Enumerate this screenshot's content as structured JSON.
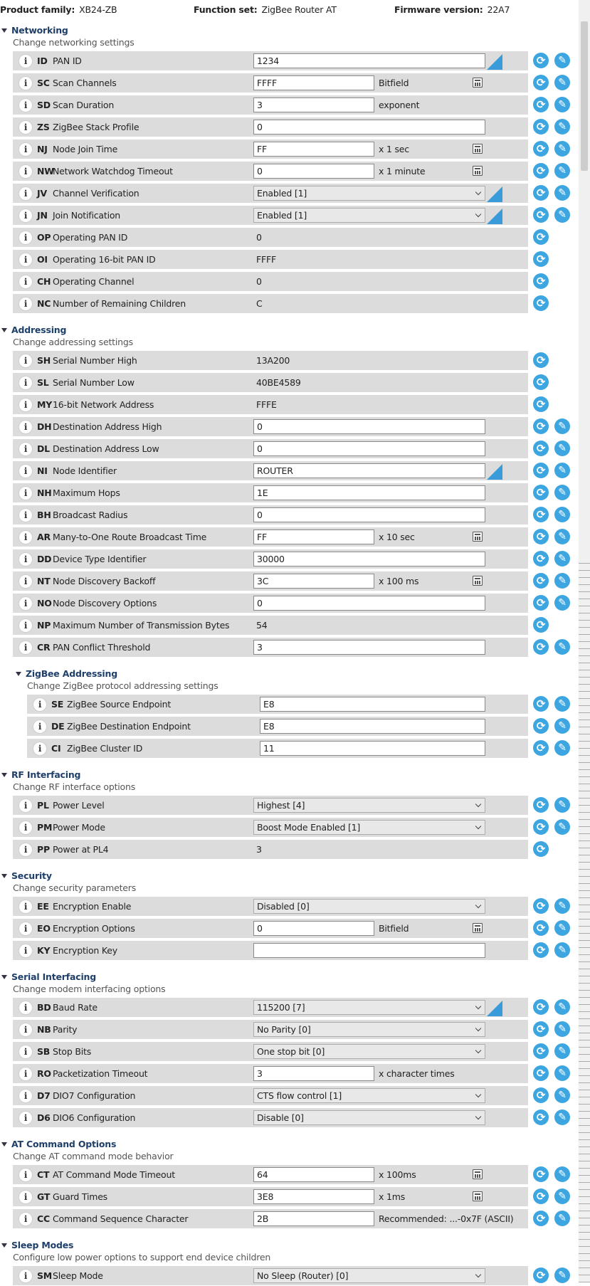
{
  "header": {
    "product_family_label": "Product family:",
    "product_family_value": "XB24-ZB",
    "function_set_label": "Function set:",
    "function_set_value": "ZigBee Router AT",
    "firmware_label": "Firmware version:",
    "firmware_value": "22A7"
  },
  "icons": {
    "info": "i",
    "read": "⟳",
    "write": "✎"
  },
  "colors": {
    "accent": "#3da6e0",
    "section_title": "#1f3f6b",
    "row_bg": "#dcdcdc"
  },
  "sections": [
    {
      "title": "Networking",
      "description": "Change networking settings",
      "rows": [
        {
          "code": "ID",
          "name": "PAN ID",
          "kind": "input",
          "value": "1234",
          "changed": true
        },
        {
          "code": "SC",
          "name": "Scan Channels",
          "kind": "input_short",
          "value": "FFFF",
          "unit": "Bitfield",
          "calc": true
        },
        {
          "code": "SD",
          "name": "Scan Duration",
          "kind": "input_short",
          "value": "3",
          "unit": "exponent"
        },
        {
          "code": "ZS",
          "name": "ZigBee Stack Profile",
          "kind": "input",
          "value": "0"
        },
        {
          "code": "NJ",
          "name": "Node Join Time",
          "kind": "input_short",
          "value": "FF",
          "unit": "x 1 sec",
          "calc": true
        },
        {
          "code": "NW",
          "name": "Network Watchdog Timeout",
          "kind": "input_short",
          "value": "0",
          "unit": "x 1 minute",
          "calc": true
        },
        {
          "code": "JV",
          "name": "Channel Verification",
          "kind": "select",
          "value": "Enabled [1]",
          "changed": true
        },
        {
          "code": "JN",
          "name": "Join Notification",
          "kind": "select",
          "value": "Enabled [1]",
          "changed": true
        },
        {
          "code": "OP",
          "name": "Operating PAN ID",
          "kind": "readonly",
          "value": "0"
        },
        {
          "code": "OI",
          "name": "Operating 16-bit PAN ID",
          "kind": "readonly",
          "value": "FFFF"
        },
        {
          "code": "CH",
          "name": "Operating Channel",
          "kind": "readonly",
          "value": "0"
        },
        {
          "code": "NC",
          "name": "Number of Remaining Children",
          "kind": "readonly",
          "value": "C"
        }
      ]
    },
    {
      "title": "Addressing",
      "description": "Change addressing settings",
      "rows": [
        {
          "code": "SH",
          "name": "Serial Number High",
          "kind": "readonly",
          "value": "13A200"
        },
        {
          "code": "SL",
          "name": "Serial Number Low",
          "kind": "readonly",
          "value": "40BE4589"
        },
        {
          "code": "MY",
          "name": "16-bit Network Address",
          "kind": "readonly",
          "value": "FFFE"
        },
        {
          "code": "DH",
          "name": "Destination Address High",
          "kind": "input",
          "value": "0"
        },
        {
          "code": "DL",
          "name": "Destination Address Low",
          "kind": "input",
          "value": "0"
        },
        {
          "code": "NI",
          "name": "Node Identifier",
          "kind": "input",
          "value": "ROUTER",
          "changed": true
        },
        {
          "code": "NH",
          "name": "Maximum Hops",
          "kind": "input",
          "value": "1E"
        },
        {
          "code": "BH",
          "name": "Broadcast Radius",
          "kind": "input",
          "value": "0"
        },
        {
          "code": "AR",
          "name": "Many-to-One Route Broadcast Time",
          "kind": "input_short",
          "value": "FF",
          "unit": "x 10 sec",
          "calc": true
        },
        {
          "code": "DD",
          "name": "Device Type Identifier",
          "kind": "input",
          "value": "30000"
        },
        {
          "code": "NT",
          "name": "Node Discovery Backoff",
          "kind": "input_short",
          "value": "3C",
          "unit": "x 100 ms",
          "calc": true
        },
        {
          "code": "NO",
          "name": "Node Discovery Options",
          "kind": "input",
          "value": "0"
        },
        {
          "code": "NP",
          "name": "Maximum Number of Transmission Bytes",
          "kind": "readonly",
          "value": "54"
        },
        {
          "code": "CR",
          "name": "PAN Conflict Threshold",
          "kind": "input",
          "value": "3"
        }
      ]
    },
    {
      "title": "ZigBee Addressing",
      "description": "Change ZigBee protocol addressing settings",
      "sub": true,
      "rows": [
        {
          "code": "SE",
          "name": "ZigBee Source Endpoint",
          "kind": "input",
          "value": "E8"
        },
        {
          "code": "DE",
          "name": "ZigBee Destination Endpoint",
          "kind": "input",
          "value": "E8"
        },
        {
          "code": "CI",
          "name": "ZigBee Cluster ID",
          "kind": "input",
          "value": "11"
        }
      ]
    },
    {
      "title": "RF Interfacing",
      "description": "Change RF interface options",
      "rows": [
        {
          "code": "PL",
          "name": "Power Level",
          "kind": "select",
          "value": "Highest [4]"
        },
        {
          "code": "PM",
          "name": "Power Mode",
          "kind": "select",
          "value": "Boost Mode Enabled [1]"
        },
        {
          "code": "PP",
          "name": "Power at PL4",
          "kind": "readonly",
          "value": "3"
        }
      ]
    },
    {
      "title": "Security",
      "description": "Change security parameters",
      "rows": [
        {
          "code": "EE",
          "name": "Encryption Enable",
          "kind": "select",
          "value": "Disabled [0]"
        },
        {
          "code": "EO",
          "name": "Encryption Options",
          "kind": "input_short",
          "value": "0",
          "unit": "Bitfield",
          "calc": true
        },
        {
          "code": "KY",
          "name": "Encryption Key",
          "kind": "input",
          "value": ""
        }
      ]
    },
    {
      "title": "Serial Interfacing",
      "description": "Change modem interfacing options",
      "rows": [
        {
          "code": "BD",
          "name": "Baud Rate",
          "kind": "select",
          "value": "115200 [7]",
          "changed": true
        },
        {
          "code": "NB",
          "name": "Parity",
          "kind": "select",
          "value": "No Parity [0]"
        },
        {
          "code": "SB",
          "name": "Stop Bits",
          "kind": "select",
          "value": "One stop bit [0]"
        },
        {
          "code": "RO",
          "name": "Packetization Timeout",
          "kind": "input_short",
          "value": "3",
          "unit": "x character times"
        },
        {
          "code": "D7",
          "name": "DIO7 Configuration",
          "kind": "select",
          "value": "CTS flow control [1]"
        },
        {
          "code": "D6",
          "name": "DIO6 Configuration",
          "kind": "select",
          "value": "Disable [0]"
        }
      ]
    },
    {
      "title": "AT Command Options",
      "description": "Change AT command mode behavior",
      "rows": [
        {
          "code": "CT",
          "name": "AT Command Mode Timeout",
          "kind": "input_short",
          "value": "64",
          "unit": "x 100ms",
          "calc": true
        },
        {
          "code": "GT",
          "name": "Guard Times",
          "kind": "input_short",
          "value": "3E8",
          "unit": "x 1ms",
          "calc": true
        },
        {
          "code": "CC",
          "name": "Command Sequence Character",
          "kind": "input_short",
          "value": "2B",
          "unit": "Recommended: ...-0x7F (ASCII)"
        }
      ]
    },
    {
      "title": "Sleep Modes",
      "description": "Configure low power options to support end device children",
      "rows": [
        {
          "code": "SM",
          "name": "Sleep Mode",
          "kind": "select",
          "value": "No Sleep (Router) [0]"
        }
      ]
    }
  ]
}
